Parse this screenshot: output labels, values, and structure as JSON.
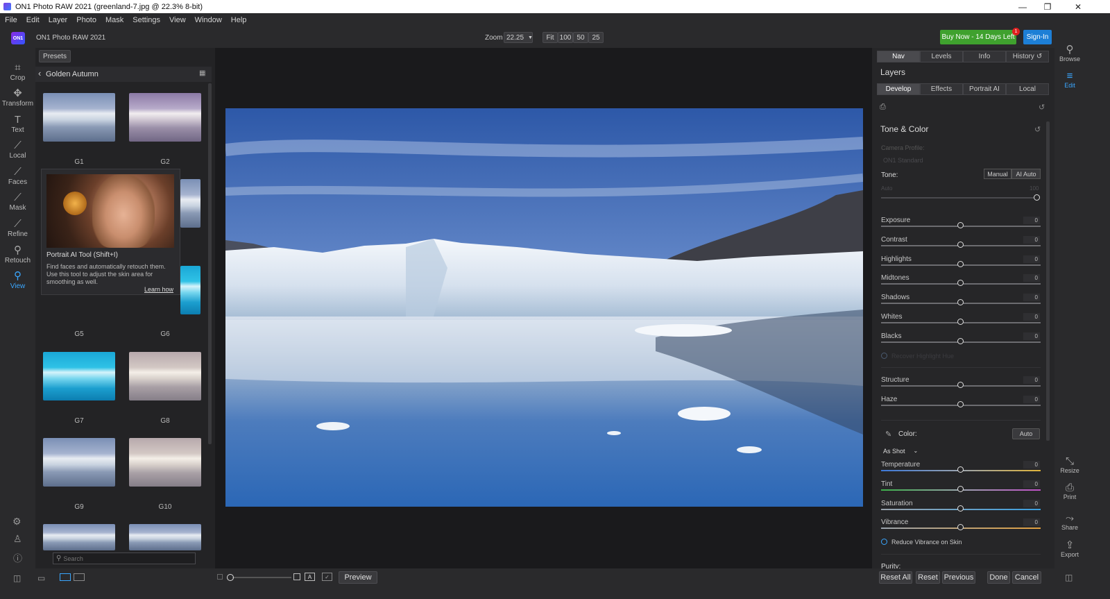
{
  "window": {
    "title": "ON1 Photo RAW 2021 (greenland-7.jpg @ 22.3% 8-bit)",
    "minimize": "—",
    "maximize": "❐",
    "close": "✕"
  },
  "menu": [
    "File",
    "Edit",
    "Layer",
    "Photo",
    "Mask",
    "Settings",
    "View",
    "Window",
    "Help"
  ],
  "topbar": {
    "logo": "ON1",
    "app_name": "ON1 Photo RAW 2021",
    "zoom_label": "Zoom",
    "zoom_value": "22.25",
    "zoom_buttons": [
      "Fit",
      "100",
      "50",
      "25"
    ],
    "buy_label": "Buy Now - 14 Days Left",
    "buy_badge": "1",
    "signin_label": "Sign-In"
  },
  "tools": [
    {
      "name": "Crop",
      "icon": "crop-icon"
    },
    {
      "name": "Transform",
      "icon": "transform-icon"
    },
    {
      "name": "Text",
      "icon": "text-icon"
    },
    {
      "name": "Local",
      "icon": "brush-icon"
    },
    {
      "name": "Faces",
      "icon": "faces-icon"
    },
    {
      "name": "Mask",
      "icon": "mask-icon"
    },
    {
      "name": "Refine",
      "icon": "refine-icon"
    },
    {
      "name": "Retouch",
      "icon": "retouch-icon"
    },
    {
      "name": "View",
      "icon": "view-icon"
    }
  ],
  "presets": {
    "tab_label": "Presets",
    "category": "Golden Autumn",
    "search_placeholder": "Search",
    "items": [
      "G1",
      "G2",
      "G5",
      "G6",
      "G7",
      "G8",
      "G9",
      "G10"
    ]
  },
  "tooltip": {
    "title": "Portrait AI Tool (Shift+I)",
    "body": "Find faces and automatically retouch them. Use this tool to adjust the skin area for smoothing as well.",
    "link": "Learn how"
  },
  "bottombar": {
    "preview_label": "Preview",
    "reset_all": "Reset All",
    "reset": "Reset",
    "previous": "Previous",
    "done": "Done",
    "cancel": "Cancel"
  },
  "rightpanel": {
    "top_tabs": [
      "Nav",
      "Levels",
      "Info",
      "History"
    ],
    "layers_label": "Layers",
    "mode_tabs": [
      "Develop",
      "Effects",
      "Portrait AI",
      "Local"
    ],
    "section_title": "Tone & Color",
    "camera_profile_label": "Camera Profile:",
    "camera_profile_value": "ON1 Standard",
    "tone_label": "Tone:",
    "tone_manual": "Manual",
    "tone_ai": "AI Auto",
    "auto_label": "Auto",
    "auto_value": "100",
    "tone_sliders": [
      {
        "label": "Exposure",
        "value": "0",
        "pos": 0.5
      },
      {
        "label": "Contrast",
        "value": "0",
        "pos": 0.5
      },
      {
        "label": "Highlights",
        "value": "0",
        "pos": 0.5
      },
      {
        "label": "Midtones",
        "value": "0",
        "pos": 0.5
      },
      {
        "label": "Shadows",
        "value": "0",
        "pos": 0.5
      },
      {
        "label": "Whites",
        "value": "0",
        "pos": 0.5
      },
      {
        "label": "Blacks",
        "value": "0",
        "pos": 0.5
      }
    ],
    "recover_label": "Recover Highlight Hue",
    "detail_sliders": [
      {
        "label": "Structure",
        "value": "0",
        "pos": 0.5
      },
      {
        "label": "Haze",
        "value": "0",
        "pos": 0.5
      }
    ],
    "color_label": "Color:",
    "color_auto": "Auto",
    "white_balance": "As Shot",
    "color_sliders": [
      {
        "label": "Temperature",
        "value": "0",
        "pos": 0.5,
        "grad": "linear-gradient(90deg,#3c78d8,#9aa3ad,#e0b43a)"
      },
      {
        "label": "Tint",
        "value": "0",
        "pos": 0.5,
        "grad": "linear-gradient(90deg,#3cb04a,#9aa3ad,#c050c8)"
      },
      {
        "label": "Saturation",
        "value": "0",
        "pos": 0.5,
        "grad": "linear-gradient(90deg,#9aa3ad,#3aa0e0)"
      },
      {
        "label": "Vibrance",
        "value": "0",
        "pos": 0.5,
        "grad": "linear-gradient(90deg,#9aa3ad,#e0a040)"
      }
    ],
    "reduce_vibrance": "Reduce Vibrance on Skin",
    "purity_label": "Purity:"
  },
  "rightstrip": [
    {
      "name": "Browse",
      "icon": "browse-icon"
    },
    {
      "name": "Edit",
      "icon": "edit-icon"
    },
    {
      "name": "Resize",
      "icon": "resize-icon"
    },
    {
      "name": "Print",
      "icon": "print-icon"
    },
    {
      "name": "Share",
      "icon": "share-icon"
    },
    {
      "name": "Export",
      "icon": "export-icon"
    }
  ],
  "colors": {
    "buy_green": "#3fa12e",
    "signin_blue": "#1d7fd6",
    "accent_blue": "#3aa7ff"
  }
}
